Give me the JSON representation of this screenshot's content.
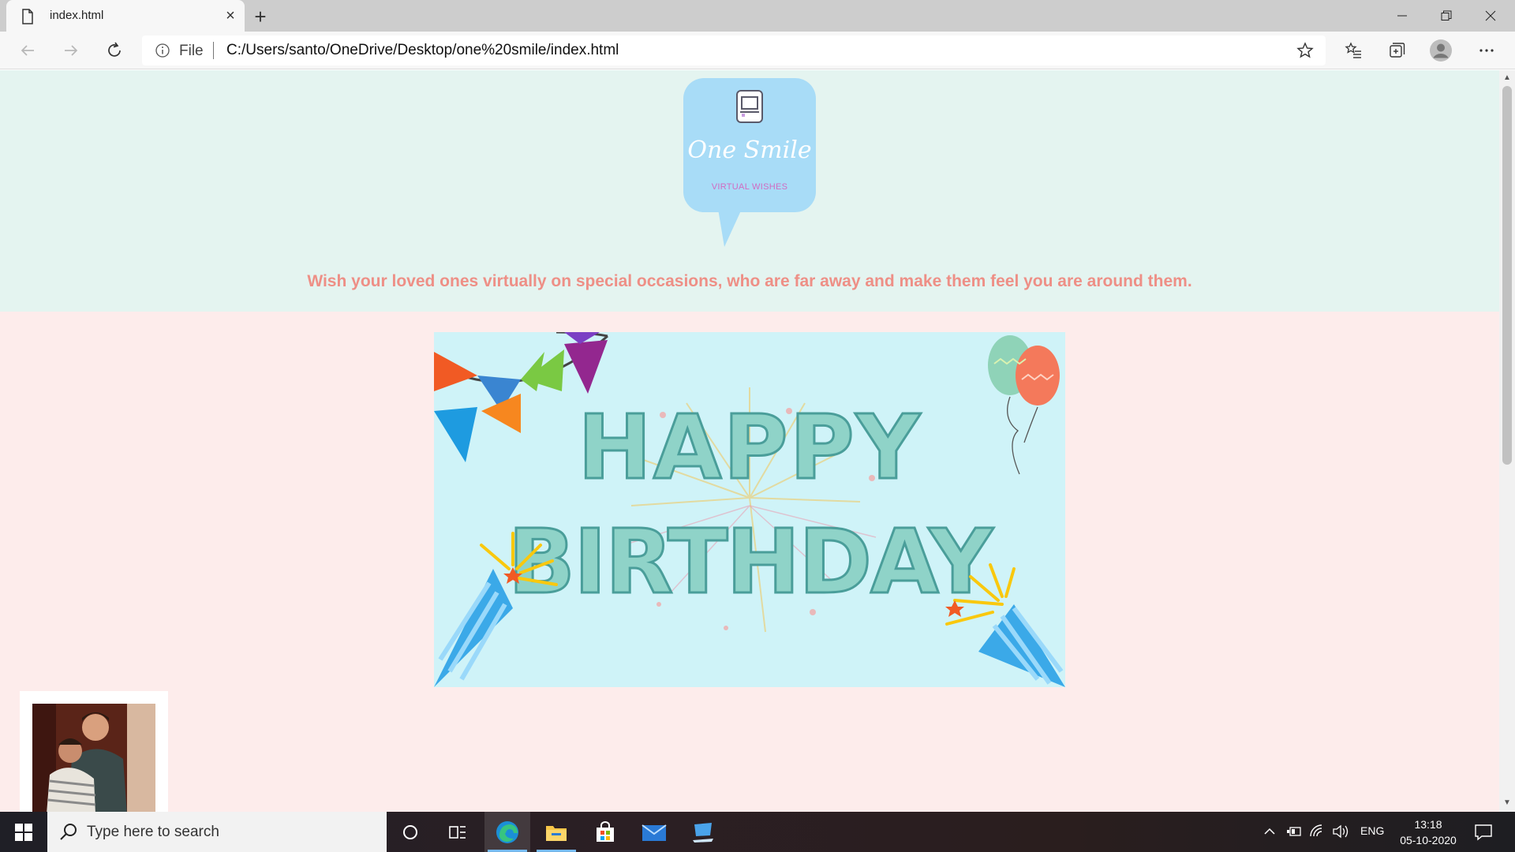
{
  "browser": {
    "tab_title": "index.html",
    "address_scheme": "File",
    "address_url": "C:/Users/santo/OneDrive/Desktop/one%20smile/index.html"
  },
  "page": {
    "logo_title": "One Smile",
    "logo_subtitle": "VIRTUAL WISHES",
    "tagline": "Wish your loved ones virtually on special occasions, who are far away and make them feel you are around them.",
    "banner_line1": "HAPPY",
    "banner_line2": "BIRTHDAY"
  },
  "taskbar": {
    "search_placeholder": "Type here to search",
    "language": "ENG",
    "time": "13:18",
    "date": "05-10-2020"
  },
  "colors": {
    "hero_bg": "#e4f4f0",
    "content_bg": "#fdeceb",
    "tagline": "#ee8f86",
    "banner_bg": "#cff3f8",
    "logo_bg": "#a8dcf7"
  }
}
